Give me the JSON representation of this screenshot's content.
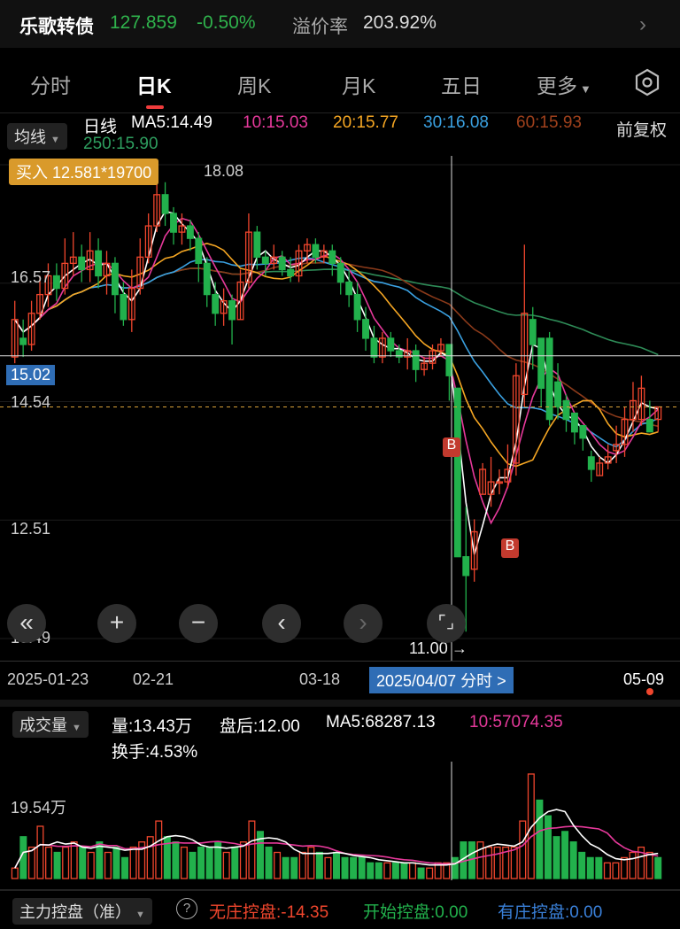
{
  "header": {
    "name": "乐歌转债",
    "price": "127.859",
    "change": "-0.50%",
    "premium_label": "溢价率",
    "premium_value": "203.92%"
  },
  "tabs": [
    "分时",
    "日K",
    "周K",
    "月K",
    "五日",
    "更多"
  ],
  "ma_bar": {
    "ind": "均线",
    "kind": "日线",
    "ma5": "MA5:14.49",
    "ma10": "10:15.03",
    "ma20": "20:15.77",
    "ma30": "30:16.08",
    "ma60": "60:15.93",
    "ma250": "250:15.90",
    "fq": "前复权"
  },
  "buy_tag": "买入 12.581*19700",
  "price_labels": {
    "top": "18.08",
    "p1": "16.57",
    "p2": "14.54",
    "p3": "12.51",
    "p4": "10.49",
    "cross": "15.02",
    "low": "11.00"
  },
  "dates": {
    "d1": "2025-01-23",
    "d2": "02-21",
    "d3": "03-18",
    "sel": "2025/04/07 分时 >",
    "d4": "05-09"
  },
  "volume": {
    "ind": "成交量",
    "vol": "量:13.43万",
    "after": "盘后:12.00",
    "ma5": "MA5:68287.13",
    "ma10": "10:57074.35",
    "turnover": "换手:4.53%",
    "scale": "19.54万"
  },
  "control": {
    "ind": "主力控盘（准）",
    "a": "无庄控盘:-14.35",
    "b": "开始控盘:0.00",
    "c": "有庄控盘:0.00"
  },
  "marker": "B",
  "colors": {
    "up": "#f0462d",
    "down": "#22b14c",
    "ma5": "#ffffff",
    "ma10": "#e6399b",
    "ma20": "#f5a623",
    "ma30": "#3aa0e0",
    "ma60": "#8b3a1a",
    "ma250": "#2e8b57"
  },
  "chart_data": {
    "type": "candlestick",
    "ylim": [
      10.49,
      18.08
    ],
    "candles": [
      {
        "o": 15.0,
        "c": 15.6,
        "h": 15.9,
        "l": 14.9
      },
      {
        "o": 15.3,
        "c": 15.2,
        "h": 15.6,
        "l": 15.0
      },
      {
        "o": 15.2,
        "c": 15.7,
        "h": 15.9,
        "l": 15.1
      },
      {
        "o": 15.7,
        "c": 16.0,
        "h": 16.3,
        "l": 15.6
      },
      {
        "o": 16.0,
        "c": 16.3,
        "h": 16.5,
        "l": 15.8
      },
      {
        "o": 16.3,
        "c": 16.1,
        "h": 16.5,
        "l": 15.9
      },
      {
        "o": 16.1,
        "c": 16.5,
        "h": 16.9,
        "l": 16.0
      },
      {
        "o": 16.5,
        "c": 16.6,
        "h": 17.0,
        "l": 16.3
      },
      {
        "o": 16.6,
        "c": 16.4,
        "h": 16.8,
        "l": 16.2
      },
      {
        "o": 16.4,
        "c": 16.7,
        "h": 17.0,
        "l": 16.2
      },
      {
        "o": 16.7,
        "c": 16.3,
        "h": 16.9,
        "l": 16.1
      },
      {
        "o": 16.3,
        "c": 16.5,
        "h": 16.7,
        "l": 16.0
      },
      {
        "o": 16.5,
        "c": 16.0,
        "h": 16.6,
        "l": 15.7
      },
      {
        "o": 16.0,
        "c": 15.6,
        "h": 16.2,
        "l": 15.5
      },
      {
        "o": 15.6,
        "c": 16.1,
        "h": 16.4,
        "l": 15.4
      },
      {
        "o": 16.1,
        "c": 16.6,
        "h": 16.9,
        "l": 16.0
      },
      {
        "o": 16.6,
        "c": 17.1,
        "h": 17.3,
        "l": 16.5
      },
      {
        "o": 17.1,
        "c": 17.6,
        "h": 18.1,
        "l": 17.0
      },
      {
        "o": 17.6,
        "c": 17.3,
        "h": 17.8,
        "l": 17.1
      },
      {
        "o": 17.3,
        "c": 17.0,
        "h": 17.4,
        "l": 16.8
      },
      {
        "o": 17.0,
        "c": 17.1,
        "h": 17.3,
        "l": 16.8
      },
      {
        "o": 17.1,
        "c": 16.9,
        "h": 17.2,
        "l": 16.7
      },
      {
        "o": 16.9,
        "c": 16.5,
        "h": 17.0,
        "l": 16.2
      },
      {
        "o": 16.5,
        "c": 16.0,
        "h": 16.6,
        "l": 15.8
      },
      {
        "o": 16.0,
        "c": 15.7,
        "h": 16.2,
        "l": 15.5
      },
      {
        "o": 15.7,
        "c": 15.9,
        "h": 16.1,
        "l": 15.5
      },
      {
        "o": 15.9,
        "c": 15.6,
        "h": 16.0,
        "l": 15.2
      },
      {
        "o": 15.6,
        "c": 16.2,
        "h": 16.4,
        "l": 15.6
      },
      {
        "o": 16.2,
        "c": 17.0,
        "h": 17.3,
        "l": 16.1
      },
      {
        "o": 17.0,
        "c": 16.6,
        "h": 17.1,
        "l": 16.4
      },
      {
        "o": 16.6,
        "c": 16.5,
        "h": 16.7,
        "l": 16.3
      },
      {
        "o": 16.5,
        "c": 16.6,
        "h": 16.8,
        "l": 16.4
      },
      {
        "o": 16.6,
        "c": 16.4,
        "h": 16.7,
        "l": 16.3
      },
      {
        "o": 16.4,
        "c": 16.3,
        "h": 16.6,
        "l": 16.2
      },
      {
        "o": 16.3,
        "c": 16.7,
        "h": 16.8,
        "l": 16.2
      },
      {
        "o": 16.7,
        "c": 16.8,
        "h": 16.9,
        "l": 16.5
      },
      {
        "o": 16.8,
        "c": 16.6,
        "h": 16.9,
        "l": 16.5
      },
      {
        "o": 16.6,
        "c": 16.7,
        "h": 16.8,
        "l": 16.5
      },
      {
        "o": 16.7,
        "c": 16.5,
        "h": 16.8,
        "l": 16.3
      },
      {
        "o": 16.5,
        "c": 16.2,
        "h": 16.6,
        "l": 16.0
      },
      {
        "o": 16.2,
        "c": 16.0,
        "h": 16.4,
        "l": 15.8
      },
      {
        "o": 16.0,
        "c": 15.6,
        "h": 16.2,
        "l": 15.4
      },
      {
        "o": 15.6,
        "c": 15.3,
        "h": 15.8,
        "l": 15.1
      },
      {
        "o": 15.3,
        "c": 15.0,
        "h": 15.5,
        "l": 14.9
      },
      {
        "o": 15.0,
        "c": 15.3,
        "h": 15.4,
        "l": 14.9
      },
      {
        "o": 15.3,
        "c": 15.1,
        "h": 15.4,
        "l": 15.0
      },
      {
        "o": 15.1,
        "c": 15.0,
        "h": 15.2,
        "l": 14.9
      },
      {
        "o": 15.0,
        "c": 15.1,
        "h": 15.3,
        "l": 14.8
      },
      {
        "o": 15.1,
        "c": 14.8,
        "h": 15.2,
        "l": 14.6
      },
      {
        "o": 14.8,
        "c": 14.9,
        "h": 15.0,
        "l": 14.7
      },
      {
        "o": 14.9,
        "c": 15.1,
        "h": 15.2,
        "l": 14.8
      },
      {
        "o": 15.1,
        "c": 15.2,
        "h": 15.3,
        "l": 15.0
      },
      {
        "o": 15.2,
        "c": 14.7,
        "h": 15.2,
        "l": 14.3
      },
      {
        "o": 14.5,
        "c": 11.8,
        "h": 13.6,
        "l": 11.8
      },
      {
        "o": 11.8,
        "c": 11.5,
        "h": 12.6,
        "l": 10.6
      },
      {
        "o": 11.6,
        "c": 12.2,
        "h": 12.4,
        "l": 11.4
      },
      {
        "o": 12.8,
        "c": 13.2,
        "h": 13.3,
        "l": 12.8
      },
      {
        "o": 12.8,
        "c": 13.0,
        "h": 13.4,
        "l": 12.6
      },
      {
        "o": 13.0,
        "c": 13.0,
        "h": 13.2,
        "l": 12.8
      },
      {
        "o": 13.0,
        "c": 13.2,
        "h": 13.6,
        "l": 12.9
      },
      {
        "o": 13.3,
        "c": 14.7,
        "h": 14.9,
        "l": 13.1
      },
      {
        "o": 14.4,
        "c": 15.7,
        "h": 16.8,
        "l": 14.2
      },
      {
        "o": 15.6,
        "c": 15.2,
        "h": 15.8,
        "l": 14.8
      },
      {
        "o": 15.3,
        "c": 14.5,
        "h": 15.3,
        "l": 14.2
      },
      {
        "o": 15.3,
        "c": 14.0,
        "h": 15.4,
        "l": 13.9
      },
      {
        "o": 14.6,
        "c": 14.2,
        "h": 14.9,
        "l": 14.0
      },
      {
        "o": 14.3,
        "c": 14.0,
        "h": 14.4,
        "l": 13.8
      },
      {
        "o": 14.1,
        "c": 13.8,
        "h": 14.1,
        "l": 13.6
      },
      {
        "o": 13.9,
        "c": 13.7,
        "h": 13.9,
        "l": 13.5
      },
      {
        "o": 13.4,
        "c": 13.2,
        "h": 13.5,
        "l": 13.0
      },
      {
        "o": 13.1,
        "c": 13.3,
        "h": 13.4,
        "l": 13.1
      },
      {
        "o": 13.3,
        "c": 13.4,
        "h": 13.6,
        "l": 13.2
      },
      {
        "o": 13.5,
        "c": 13.6,
        "h": 13.9,
        "l": 13.3
      },
      {
        "o": 13.6,
        "c": 14.0,
        "h": 14.2,
        "l": 13.4
      },
      {
        "o": 14.0,
        "c": 14.3,
        "h": 14.6,
        "l": 13.8
      },
      {
        "o": 14.0,
        "c": 14.5,
        "h": 14.7,
        "l": 13.9
      },
      {
        "o": 14.0,
        "c": 13.8,
        "h": 14.3,
        "l": 13.8
      },
      {
        "o": 14.0,
        "c": 14.2,
        "h": 14.2,
        "l": 13.8
      }
    ],
    "volume_ratio": [
      0.1,
      0.4,
      0.3,
      0.5,
      0.3,
      0.25,
      0.3,
      0.35,
      0.3,
      0.25,
      0.35,
      0.25,
      0.3,
      0.2,
      0.3,
      0.35,
      0.4,
      0.55,
      0.4,
      0.35,
      0.3,
      0.25,
      0.3,
      0.3,
      0.35,
      0.25,
      0.3,
      0.35,
      0.55,
      0.45,
      0.3,
      0.25,
      0.2,
      0.2,
      0.25,
      0.3,
      0.25,
      0.2,
      0.25,
      0.2,
      0.2,
      0.2,
      0.15,
      0.15,
      0.15,
      0.15,
      0.15,
      0.15,
      0.1,
      0.1,
      0.15,
      0.15,
      0.2,
      0.35,
      0.35,
      0.35,
      0.3,
      0.3,
      0.3,
      0.3,
      0.55,
      1.0,
      0.75,
      0.6,
      0.4,
      0.45,
      0.35,
      0.25,
      0.2,
      0.2,
      0.15,
      0.15,
      0.2,
      0.25,
      0.3,
      0.25,
      0.2
    ]
  }
}
